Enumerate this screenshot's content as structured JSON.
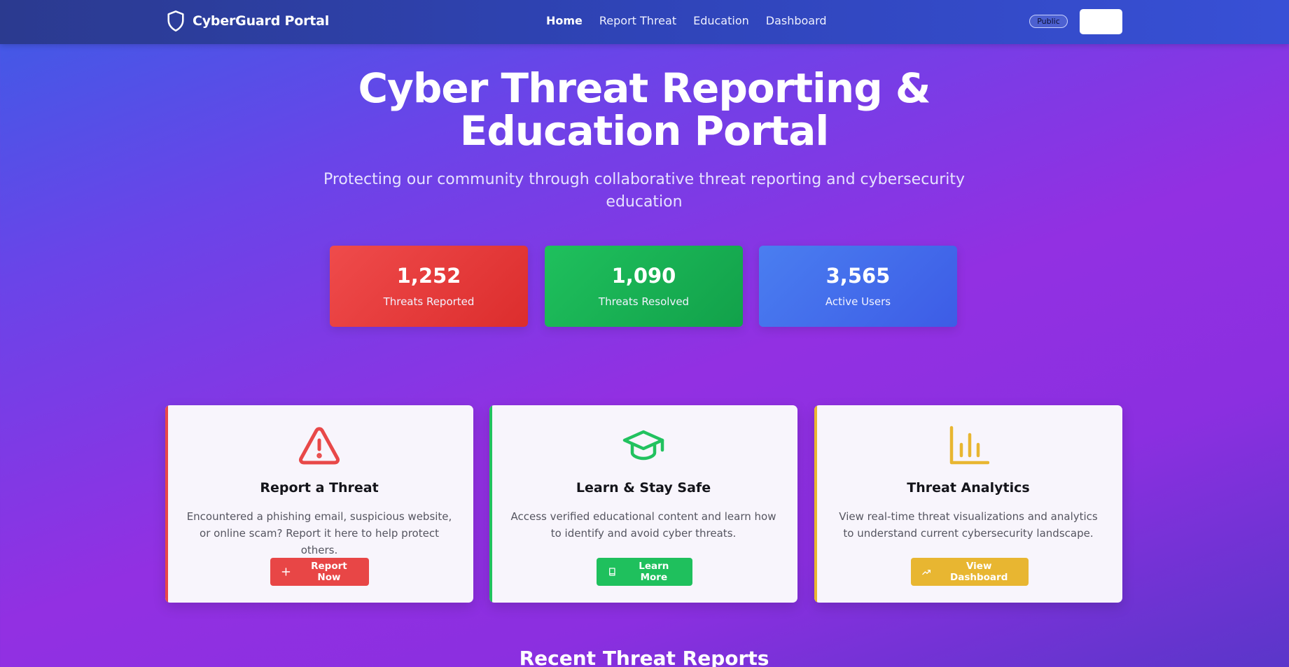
{
  "navbar": {
    "brand_name": "CyberGuard Portal",
    "brand_icon": "shield-icon",
    "links": [
      {
        "label": "Home",
        "active": true
      },
      {
        "label": "Report Threat",
        "active": false
      },
      {
        "label": "Education",
        "active": false
      },
      {
        "label": "Dashboard",
        "active": false
      }
    ],
    "badge": "Public"
  },
  "hero": {
    "title_line1": "Cyber Threat Reporting &",
    "title_line2": "Education Portal",
    "subtitle": "Protecting our community through collaborative threat reporting and cybersecurity education"
  },
  "stats": [
    {
      "value": "1,252",
      "label": "Threats Reported",
      "color": "#e84848"
    },
    {
      "value": "1,090",
      "label": "Threats Resolved",
      "color": "#1fb156"
    },
    {
      "value": "3,565",
      "label": "Active Users",
      "color": "#4a70ec"
    }
  ],
  "features": [
    {
      "icon": "warning-triangle-icon",
      "title": "Report a Threat",
      "description": "Encountered a phishing email, suspicious website, or online scam? Report it here to help protect others.",
      "button_label": "Report Now",
      "button_icon": "plus-icon",
      "accent": "#e84848"
    },
    {
      "icon": "graduation-cap-icon",
      "title": "Learn & Stay Safe",
      "description": "Access verified educational content and learn how to identify and avoid cyber threats.",
      "button_label": "Learn More",
      "button_icon": "book-icon",
      "accent": "#22c25f"
    },
    {
      "icon": "bar-chart-icon",
      "title": "Threat Analytics",
      "description": "View real-time threat visualizations and analytics to understand current cybersecurity landscape.",
      "button_label": "View Dashboard",
      "button_icon": "trending-up-icon",
      "accent": "#e8b631"
    }
  ],
  "recent": {
    "title": "Recent Threat Reports"
  }
}
